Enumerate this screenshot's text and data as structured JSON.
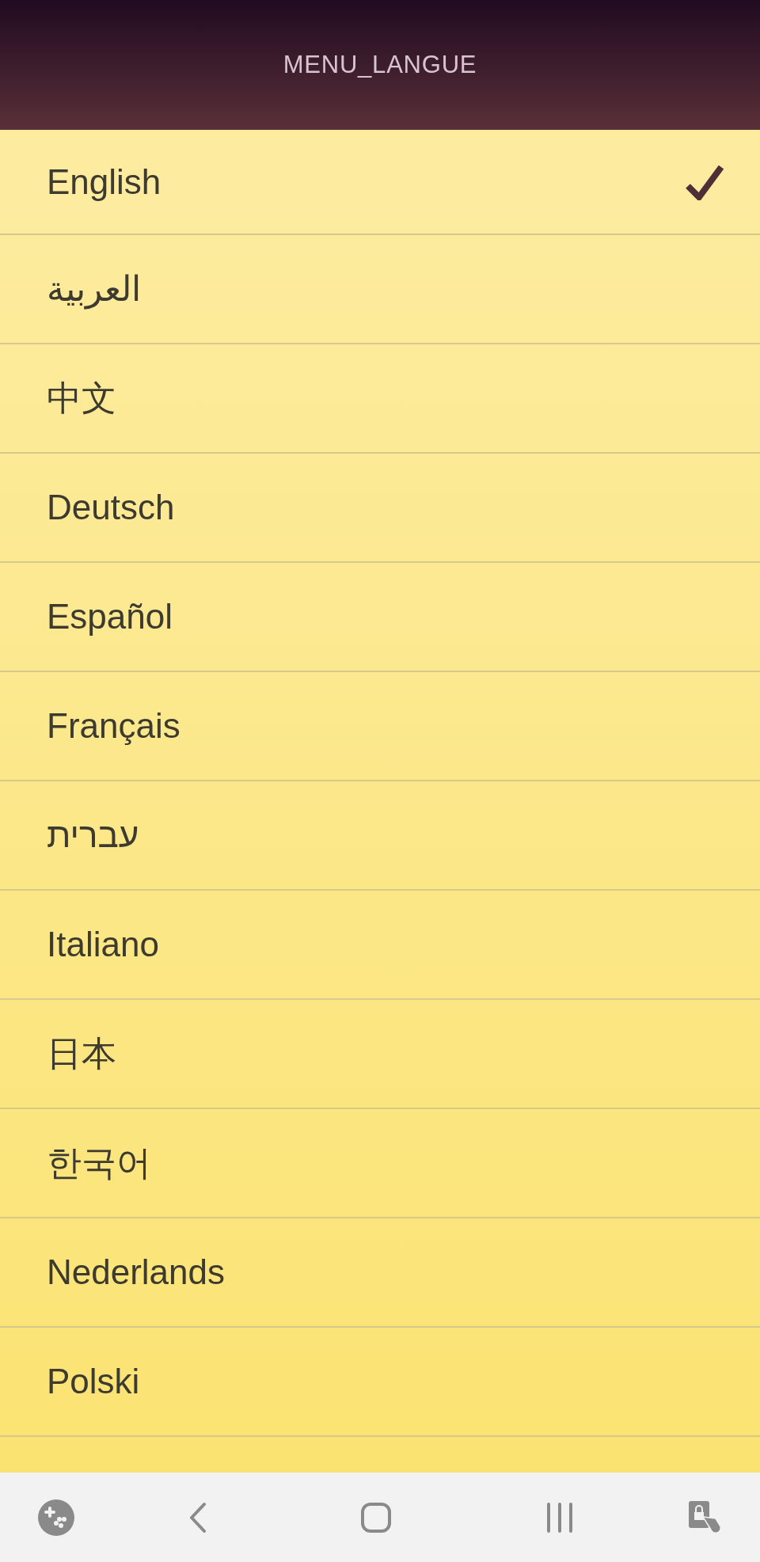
{
  "header": {
    "title": "MENU_LANGUE"
  },
  "languages": [
    {
      "label": "English",
      "selected": true
    },
    {
      "label": "العربية",
      "selected": false
    },
    {
      "label": "中文",
      "selected": false
    },
    {
      "label": "Deutsch",
      "selected": false
    },
    {
      "label": "Español",
      "selected": false
    },
    {
      "label": "Français",
      "selected": false
    },
    {
      "label": "עברית",
      "selected": false
    },
    {
      "label": "Italiano",
      "selected": false
    },
    {
      "label": "日本",
      "selected": false
    },
    {
      "label": "한국어",
      "selected": false
    },
    {
      "label": "Nederlands",
      "selected": false
    },
    {
      "label": "Polski",
      "selected": false
    }
  ]
}
